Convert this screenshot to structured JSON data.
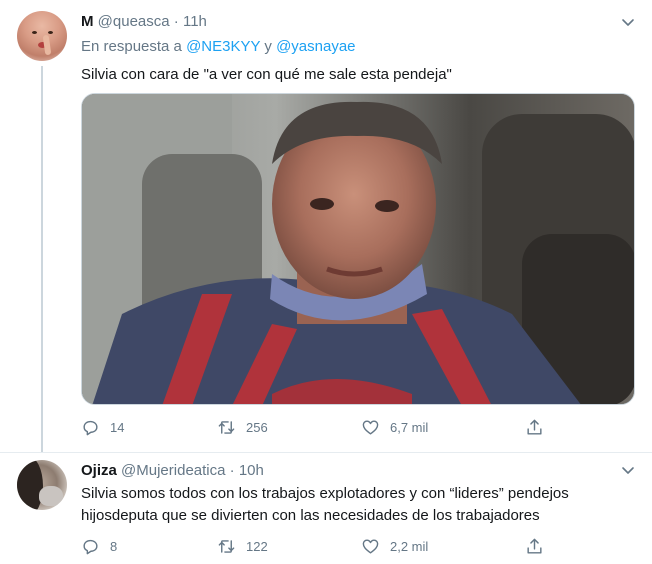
{
  "tweets": [
    {
      "name": "M",
      "handle": "@queasca",
      "dot": "·",
      "time": "11h",
      "reply_prefix": "En respuesta a",
      "mention_1": "@NE3KYY",
      "reply_and": "y",
      "mention_2": "@yasnayae",
      "text": "Silvia con cara de \"a ver con qué me sale esta pendeja\"",
      "replies": "14",
      "retweets": "256",
      "likes": "6,7 mil"
    },
    {
      "name": "Ojiza",
      "handle": "@Mujerideatica",
      "dot": "·",
      "time": "10h",
      "text": "Silvia somos todos con los trabajos explotadores y con “lideres” pendejos hijosdeputa que se divierten con las necesidades de los trabajadores",
      "replies": "8",
      "retweets": "122",
      "likes": "2,2 mil"
    }
  ],
  "icons": {
    "caret": "chevron-down-icon",
    "reply": "reply-icon",
    "retweet": "retweet-icon",
    "like": "heart-icon",
    "share": "share-icon"
  },
  "colors": {
    "text": "#14171a",
    "secondary": "#657786",
    "link": "#1da1f2",
    "border": "#ccd6dd"
  }
}
